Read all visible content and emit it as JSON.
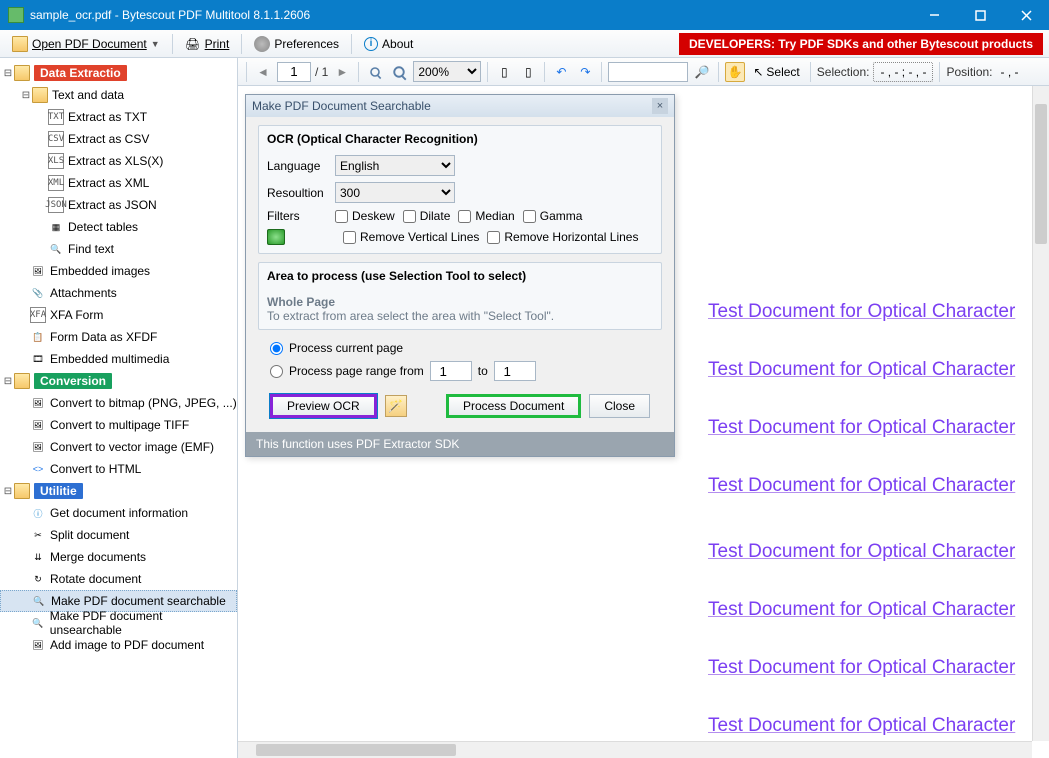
{
  "window": {
    "title": "sample_ocr.pdf - Bytescout PDF Multitool 8.1.1.2606"
  },
  "menubar": {
    "open": "Open PDF Document",
    "print": "Print",
    "prefs": "Preferences",
    "about": "About",
    "dev_banner": "DEVELOPERS: Try PDF SDKs and other Bytescout products"
  },
  "toolbar": {
    "page_current": "1",
    "page_total": "/ 1",
    "zoom": "200%",
    "select": "Select",
    "selection_label": "Selection:",
    "selection_value": "- , - ; - , -",
    "position_label": "Position:",
    "position_value": "- , -"
  },
  "sidebar": {
    "data_extraction": "Data Extractio",
    "text_and_data": "Text and data",
    "extract_txt": "Extract as TXT",
    "extract_csv": "Extract as CSV",
    "extract_xls": "Extract as XLS(X)",
    "extract_xml": "Extract as XML",
    "extract_json": "Extract as JSON",
    "detect_tables": "Detect tables",
    "find_text": "Find text",
    "embedded_images": "Embedded images",
    "attachments": "Attachments",
    "xfa_form": "XFA Form",
    "form_data_xfdf": "Form Data as XFDF",
    "embedded_multimedia": "Embedded multimedia",
    "conversion": "Conversion",
    "convert_bitmap": "Convert to bitmap (PNG, JPEG, ...)",
    "convert_tiff": "Convert to multipage TIFF",
    "convert_vector": "Convert to vector image (EMF)",
    "convert_html": "Convert to HTML",
    "utilities": "Utilitie",
    "get_info": "Get document information",
    "split": "Split document",
    "merge": "Merge documents",
    "rotate": "Rotate document",
    "make_searchable": "Make PDF document searchable",
    "make_unsearchable": "Make PDF document unsearchable",
    "add_image": "Add image to PDF document"
  },
  "dialog": {
    "title": "Make PDF Document Searchable",
    "ocr_header": "OCR (Optical Character Recognition)",
    "language_label": "Language",
    "language_value": "English",
    "resolution_label": "Resoultion",
    "resolution_value": "300",
    "filters_label": "Filters",
    "deskew": "Deskew",
    "dilate": "Dilate",
    "median": "Median",
    "gamma": "Gamma",
    "remove_v": "Remove Vertical Lines",
    "remove_h": "Remove Horizontal Lines",
    "area_header": "Area to process (use Selection Tool to select)",
    "whole_page": "Whole Page",
    "area_hint": "To extract from area select the area with \"Select Tool\".",
    "process_current": "Process current page",
    "process_range": "Process page range from",
    "range_from": "1",
    "range_to_label": "to",
    "range_to": "1",
    "preview_btn": "Preview OCR",
    "process_btn": "Process Document",
    "close_btn": "Close",
    "footer": "This function uses PDF Extractor SDK"
  },
  "preview_line": "Test Document for Optical Character"
}
